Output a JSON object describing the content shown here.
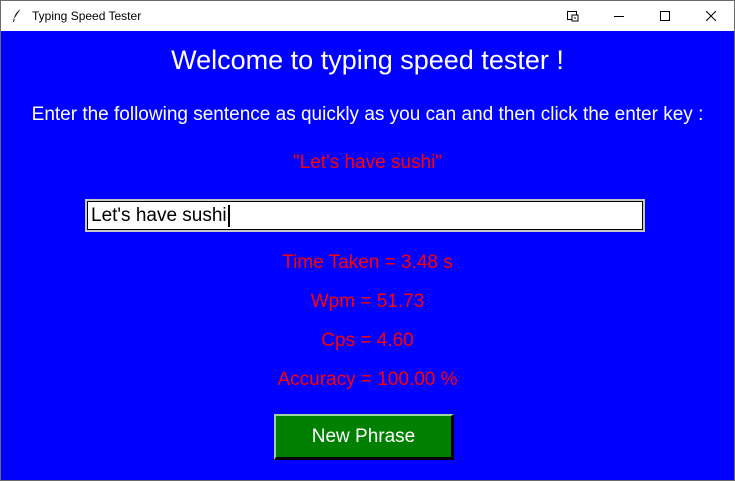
{
  "window": {
    "title": "Typing Speed Tester",
    "icon": "feather-icon",
    "controls": [
      "pin-icon",
      "minimize-icon",
      "maximize-icon",
      "close-icon"
    ]
  },
  "colors": {
    "background": "#0000ff",
    "heading_text": "#ffffff",
    "highlight_text": "#ff0000",
    "button": "#008000",
    "button_text": "#ffffff"
  },
  "main": {
    "heading": "Welcome to typing speed tester !",
    "instruction": "Enter the following sentence as quickly as you can and then click the enter key :",
    "sentence": "\"Let's have sushi\"",
    "input": {
      "value": "Let's have sushi"
    },
    "stats": {
      "time_taken": "Time Taken =  3.48 s",
      "wpm": "Wpm =  51.73",
      "cps": "Cps =  4.60",
      "accuracy": "Accuracy =  100.00 %"
    },
    "new_phrase_label": "New Phrase"
  }
}
